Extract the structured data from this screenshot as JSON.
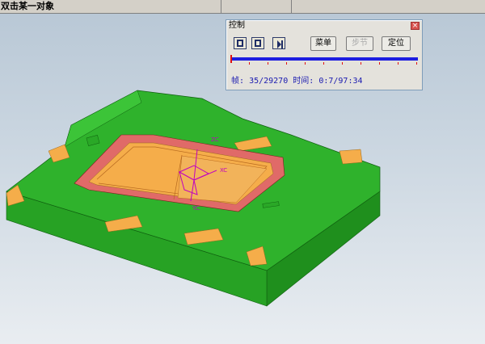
{
  "statusbar": {
    "prompt": "双击某一对象"
  },
  "panel": {
    "title": "控制",
    "close_glyph": "×",
    "buttons": {
      "menu": "菜单",
      "step": "步节",
      "locate": "定位"
    },
    "frame_label": "帧:",
    "frame_value": "35/29270",
    "time_label": "时间:",
    "time_value": "0:7/97:34",
    "progress_fraction": 0.0012
  },
  "axes": {
    "z": "ZC",
    "x": "XC",
    "y": "YC"
  },
  "colors": {
    "mold_green": "#2fb22c",
    "mold_green_dark": "#1f8f1d",
    "pocket_orange": "#f5ad4a",
    "cavity_red": "#e06a68",
    "track_blue": "#1d1de0",
    "axis_magenta": "#c000c0"
  },
  "icons": [
    "stop-icon",
    "pause-icon",
    "step-forward-icon",
    "close-icon"
  ]
}
